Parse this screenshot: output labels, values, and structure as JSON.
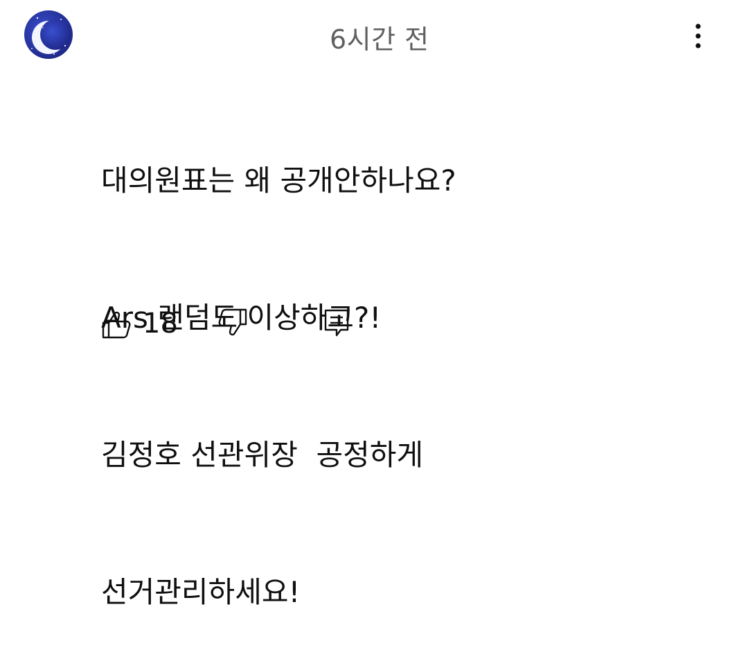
{
  "comment": {
    "timestamp": "6시간 전",
    "lines": [
      "대의원표는 왜 공개안하나요?",
      "Ars 랜덤도 이상하고?!",
      "김정호 선관위장  공정하게",
      "선거관리하세요!"
    ],
    "like_count": "18"
  },
  "icons": {
    "avatar": "crescent-moon-avatar",
    "more": "more-vertical-icon",
    "like": "thumbs-up-icon",
    "dislike": "thumbs-down-icon",
    "reply": "comment-icon"
  },
  "colors": {
    "avatar_bg": "#2b3aa8",
    "text": "#0f0f0f",
    "muted": "#606060"
  }
}
